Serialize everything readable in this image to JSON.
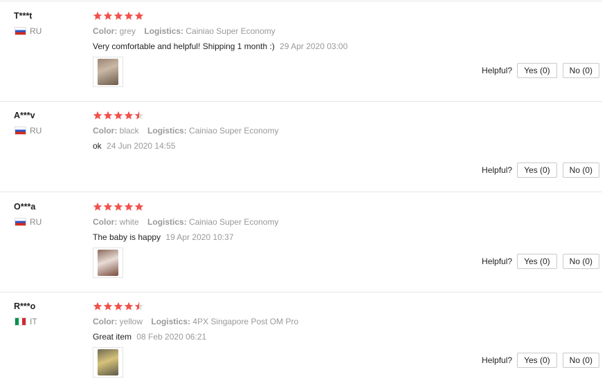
{
  "labels": {
    "color": "Color:",
    "logistics": "Logistics:",
    "helpful": "Helpful?"
  },
  "star_color": "#f2514b",
  "star_empty_color": "#dddddd",
  "reviews": [
    {
      "user": "T***t",
      "country": "RU",
      "rating": 5,
      "color": "grey",
      "logistics": "Cainiao Super Economy",
      "comment": "Very comfortable and helpful! Shipping 1 month :)",
      "date": "29 Apr 2020 03:00",
      "has_photo": true,
      "yes": "Yes (0)",
      "no": "No (0)"
    },
    {
      "user": "A***v",
      "country": "RU",
      "rating": 4.5,
      "color": "black",
      "logistics": "Cainiao Super Economy",
      "comment": "ok",
      "date": "24 Jun 2020 14:55",
      "has_photo": false,
      "yes": "Yes (0)",
      "no": "No (0)"
    },
    {
      "user": "O***a",
      "country": "RU",
      "rating": 5,
      "color": "white",
      "logistics": "Cainiao Super Economy",
      "comment": "The baby is happy",
      "date": "19 Apr 2020 10:37",
      "has_photo": true,
      "yes": "Yes (0)",
      "no": "No (0)"
    },
    {
      "user": "R***o",
      "country": "IT",
      "rating": 4.5,
      "color": "yellow",
      "logistics": "4PX Singapore Post OM Pro",
      "comment": "Great item",
      "date": "08 Feb 2020 06:21",
      "has_photo": true,
      "yes": "Yes (0)",
      "no": "No (0)"
    }
  ]
}
